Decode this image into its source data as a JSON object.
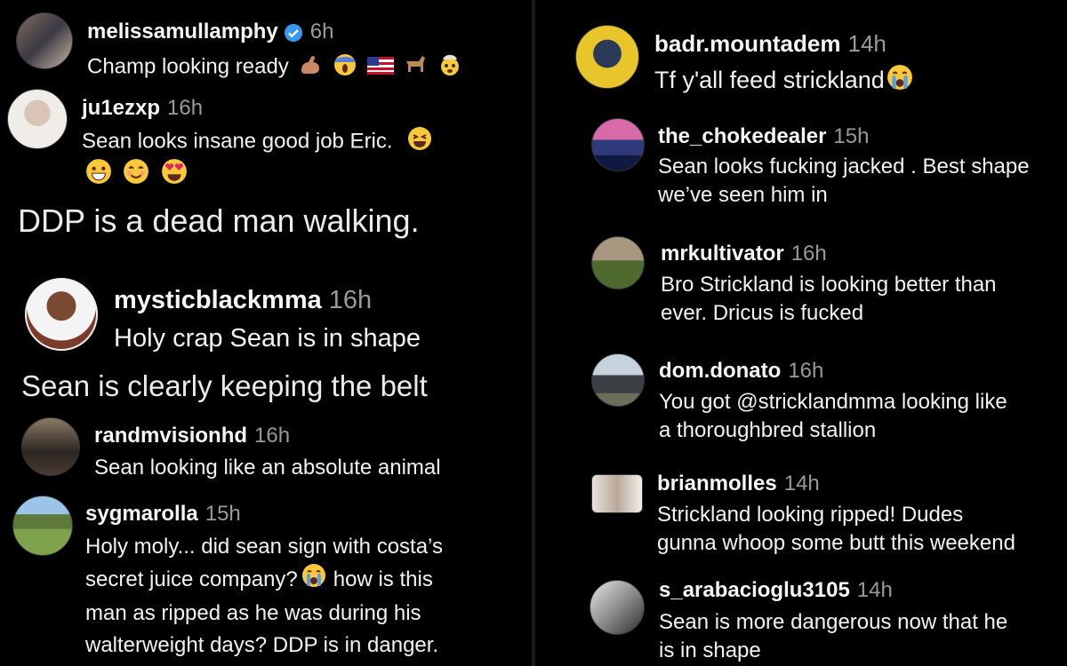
{
  "left": {
    "c1": {
      "username": "melissamullamphy",
      "time": "6h",
      "text": "Champ looking ready"
    },
    "c2": {
      "username": "ju1ezxp",
      "time": "16h",
      "text": "Sean looks insane good job Eric."
    },
    "caption1": "DDP is a dead man walking.",
    "c3": {
      "username": "mysticblackmma",
      "time": "16h",
      "text": "Holy crap Sean is in shape"
    },
    "caption2": "Sean is clearly keeping the belt",
    "c4": {
      "username": "randmvisionhd",
      "time": "16h",
      "text": "Sean looking like an absolute animal"
    },
    "c5": {
      "username": "sygmarolla",
      "time": "15h",
      "line1": "Holy moly... did sean sign with costa’s",
      "line2a": "secret juice company?",
      "line2b": "how is this",
      "line3": "man as ripped as he was during his",
      "line4": "walterweight days? DDP is in danger."
    }
  },
  "right": {
    "c1": {
      "username": "badr.mountadem",
      "time": "14h",
      "text": "Tf y'all feed strickland"
    },
    "c2": {
      "username": "the_chokedealer",
      "time": "15h",
      "line1": "Sean looks fucking jacked . Best shape",
      "line2": "we’ve seen him in"
    },
    "c3": {
      "username": "mrkultivator",
      "time": "16h",
      "line1": "Bro Strickland is looking better than",
      "line2": "ever. Dricus is fucked"
    },
    "c4": {
      "username": "dom.donato",
      "time": "16h",
      "line1": "You got @stricklandmma looking like",
      "line2": "a thoroughbred stallion"
    },
    "c5": {
      "username": "brianmolles",
      "time": "14h",
      "line1": "Strickland looking ripped! Dudes",
      "line2": "gunna whoop some butt this weekend"
    },
    "c6": {
      "username": "s_arabacioglu3105",
      "time": "14h",
      "line1": "Sean is more dangerous now that he",
      "line2": "is in shape"
    }
  },
  "icons": [
    "verified-badge-icon",
    "flexed-biceps-icon",
    "screaming-face-icon",
    "us-flag-icon",
    "goat-icon",
    "exploding-head-icon",
    "squinting-laugh-icon",
    "grinning-face-icon",
    "smiling-face-icon",
    "heart-eyes-icon",
    "crying-face-icon"
  ],
  "colors": {
    "background": "#000000",
    "text": "#f2f2f2",
    "timestamp": "#9a9a9a",
    "verified": "#3897f0"
  }
}
